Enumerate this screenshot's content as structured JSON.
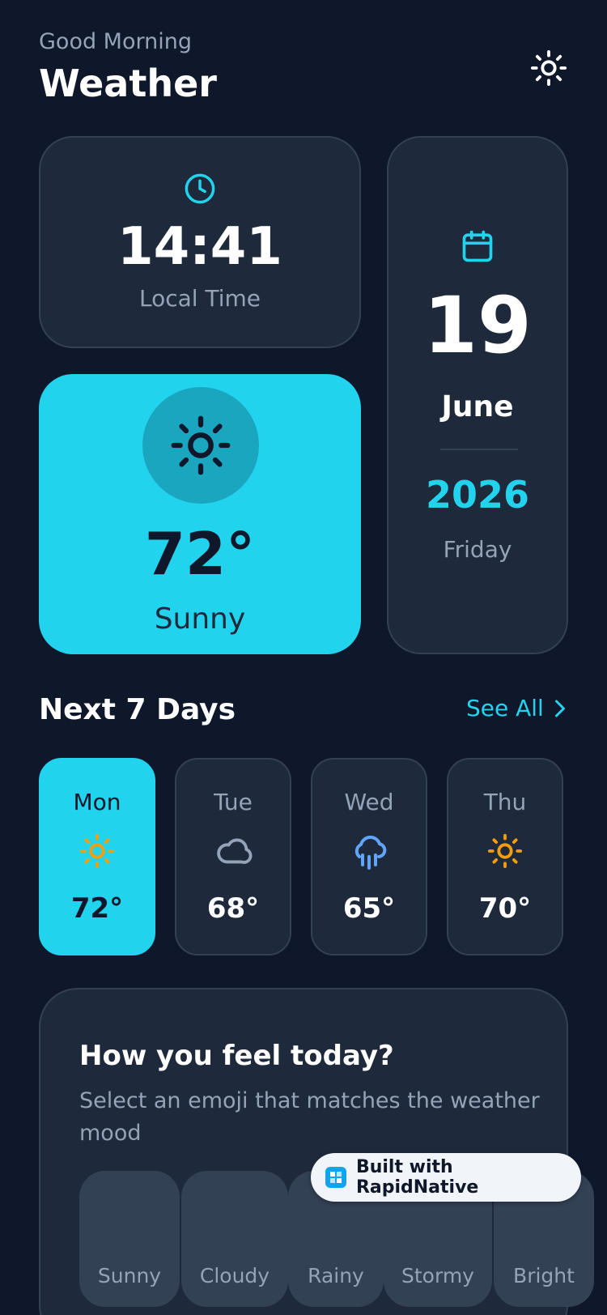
{
  "header": {
    "greeting": "Good Morning",
    "title": "Weather"
  },
  "time_card": {
    "time": "14:41",
    "label": "Local Time"
  },
  "date_card": {
    "day": "19",
    "month": "June",
    "year": "2026",
    "weekday": "Friday"
  },
  "current_weather": {
    "temperature": "72°",
    "condition": "Sunny",
    "icon": "sun-icon"
  },
  "forecast": {
    "section_title": "Next 7 Days",
    "see_all_label": "See All",
    "days": [
      {
        "name": "Mon",
        "temp": "72°",
        "icon": "sun-icon",
        "active": true
      },
      {
        "name": "Tue",
        "temp": "68°",
        "icon": "cloud-icon",
        "active": false
      },
      {
        "name": "Wed",
        "temp": "65°",
        "icon": "rain-icon",
        "active": false
      },
      {
        "name": "Thu",
        "temp": "70°",
        "icon": "sun-icon",
        "active": false
      }
    ]
  },
  "mood": {
    "title": "How you feel today?",
    "subtitle": "Select an emoji that matches the weather mood",
    "options": [
      {
        "label": "Sunny"
      },
      {
        "label": "Cloudy"
      },
      {
        "label": "Rainy"
      },
      {
        "label": "Stormy"
      },
      {
        "label": "Bright"
      }
    ]
  },
  "badge": {
    "label": "Built with RapidNative"
  },
  "colors": {
    "background": "#0f172a",
    "card": "#1e293b",
    "accent": "#22d3ee",
    "sun_orange": "#f59e0b",
    "rain_blue": "#60a5fa",
    "muted_text": "#94a3b8"
  }
}
